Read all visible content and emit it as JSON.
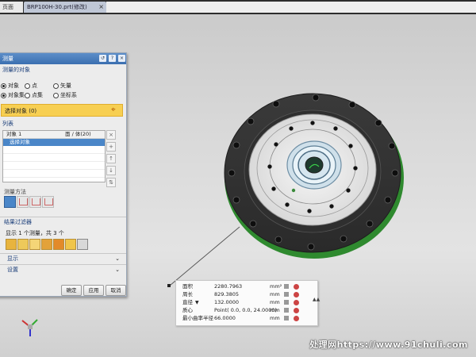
{
  "tabs": {
    "home": "页面",
    "file": "BRP100H-30.prt(修改)",
    "file_close": "×"
  },
  "dialog": {
    "title": "测量",
    "title_buttons": [
      "↺",
      "?",
      "×"
    ],
    "objects_section": "测量的对象",
    "radio": [
      {
        "label": "对象",
        "on": true
      },
      {
        "label": "点",
        "on": false
      },
      {
        "label": "矢量",
        "on": false
      },
      {
        "label": "对象集",
        "on": true
      },
      {
        "label": "点集",
        "on": false
      },
      {
        "label": "坐标系",
        "on": false
      }
    ],
    "select_label": "选择对象 (0)",
    "list_section": "列表",
    "list_col1": "对象 1",
    "list_col2": "面 / 体(20)",
    "list_selected": "选择对象",
    "method_label": "测量方法",
    "filter_section": "结果过滤器",
    "filter_text": "显示 1 个测量，共 3 个",
    "display_section": "显示",
    "settings_section": "设置",
    "ok_button": "确定",
    "apply_button": "应用",
    "cancel_button": "取消"
  },
  "measurements": [
    {
      "label": "面积",
      "value": "2280.7963",
      "unit": "mm²"
    },
    {
      "label": "周长",
      "value": "829.3805",
      "unit": "mm"
    },
    {
      "label": "直径",
      "value": "132.0000",
      "unit": "mm"
    },
    {
      "label": "质心",
      "value": "Point( 0.0, 0.0, 24.0000)",
      "unit": "mm"
    },
    {
      "label": "最小曲率半径",
      "value": "66.0000",
      "unit": "mm"
    }
  ],
  "info_side_tag": "▲▲",
  "watermark": "处理网https://www.91chuli.com"
}
